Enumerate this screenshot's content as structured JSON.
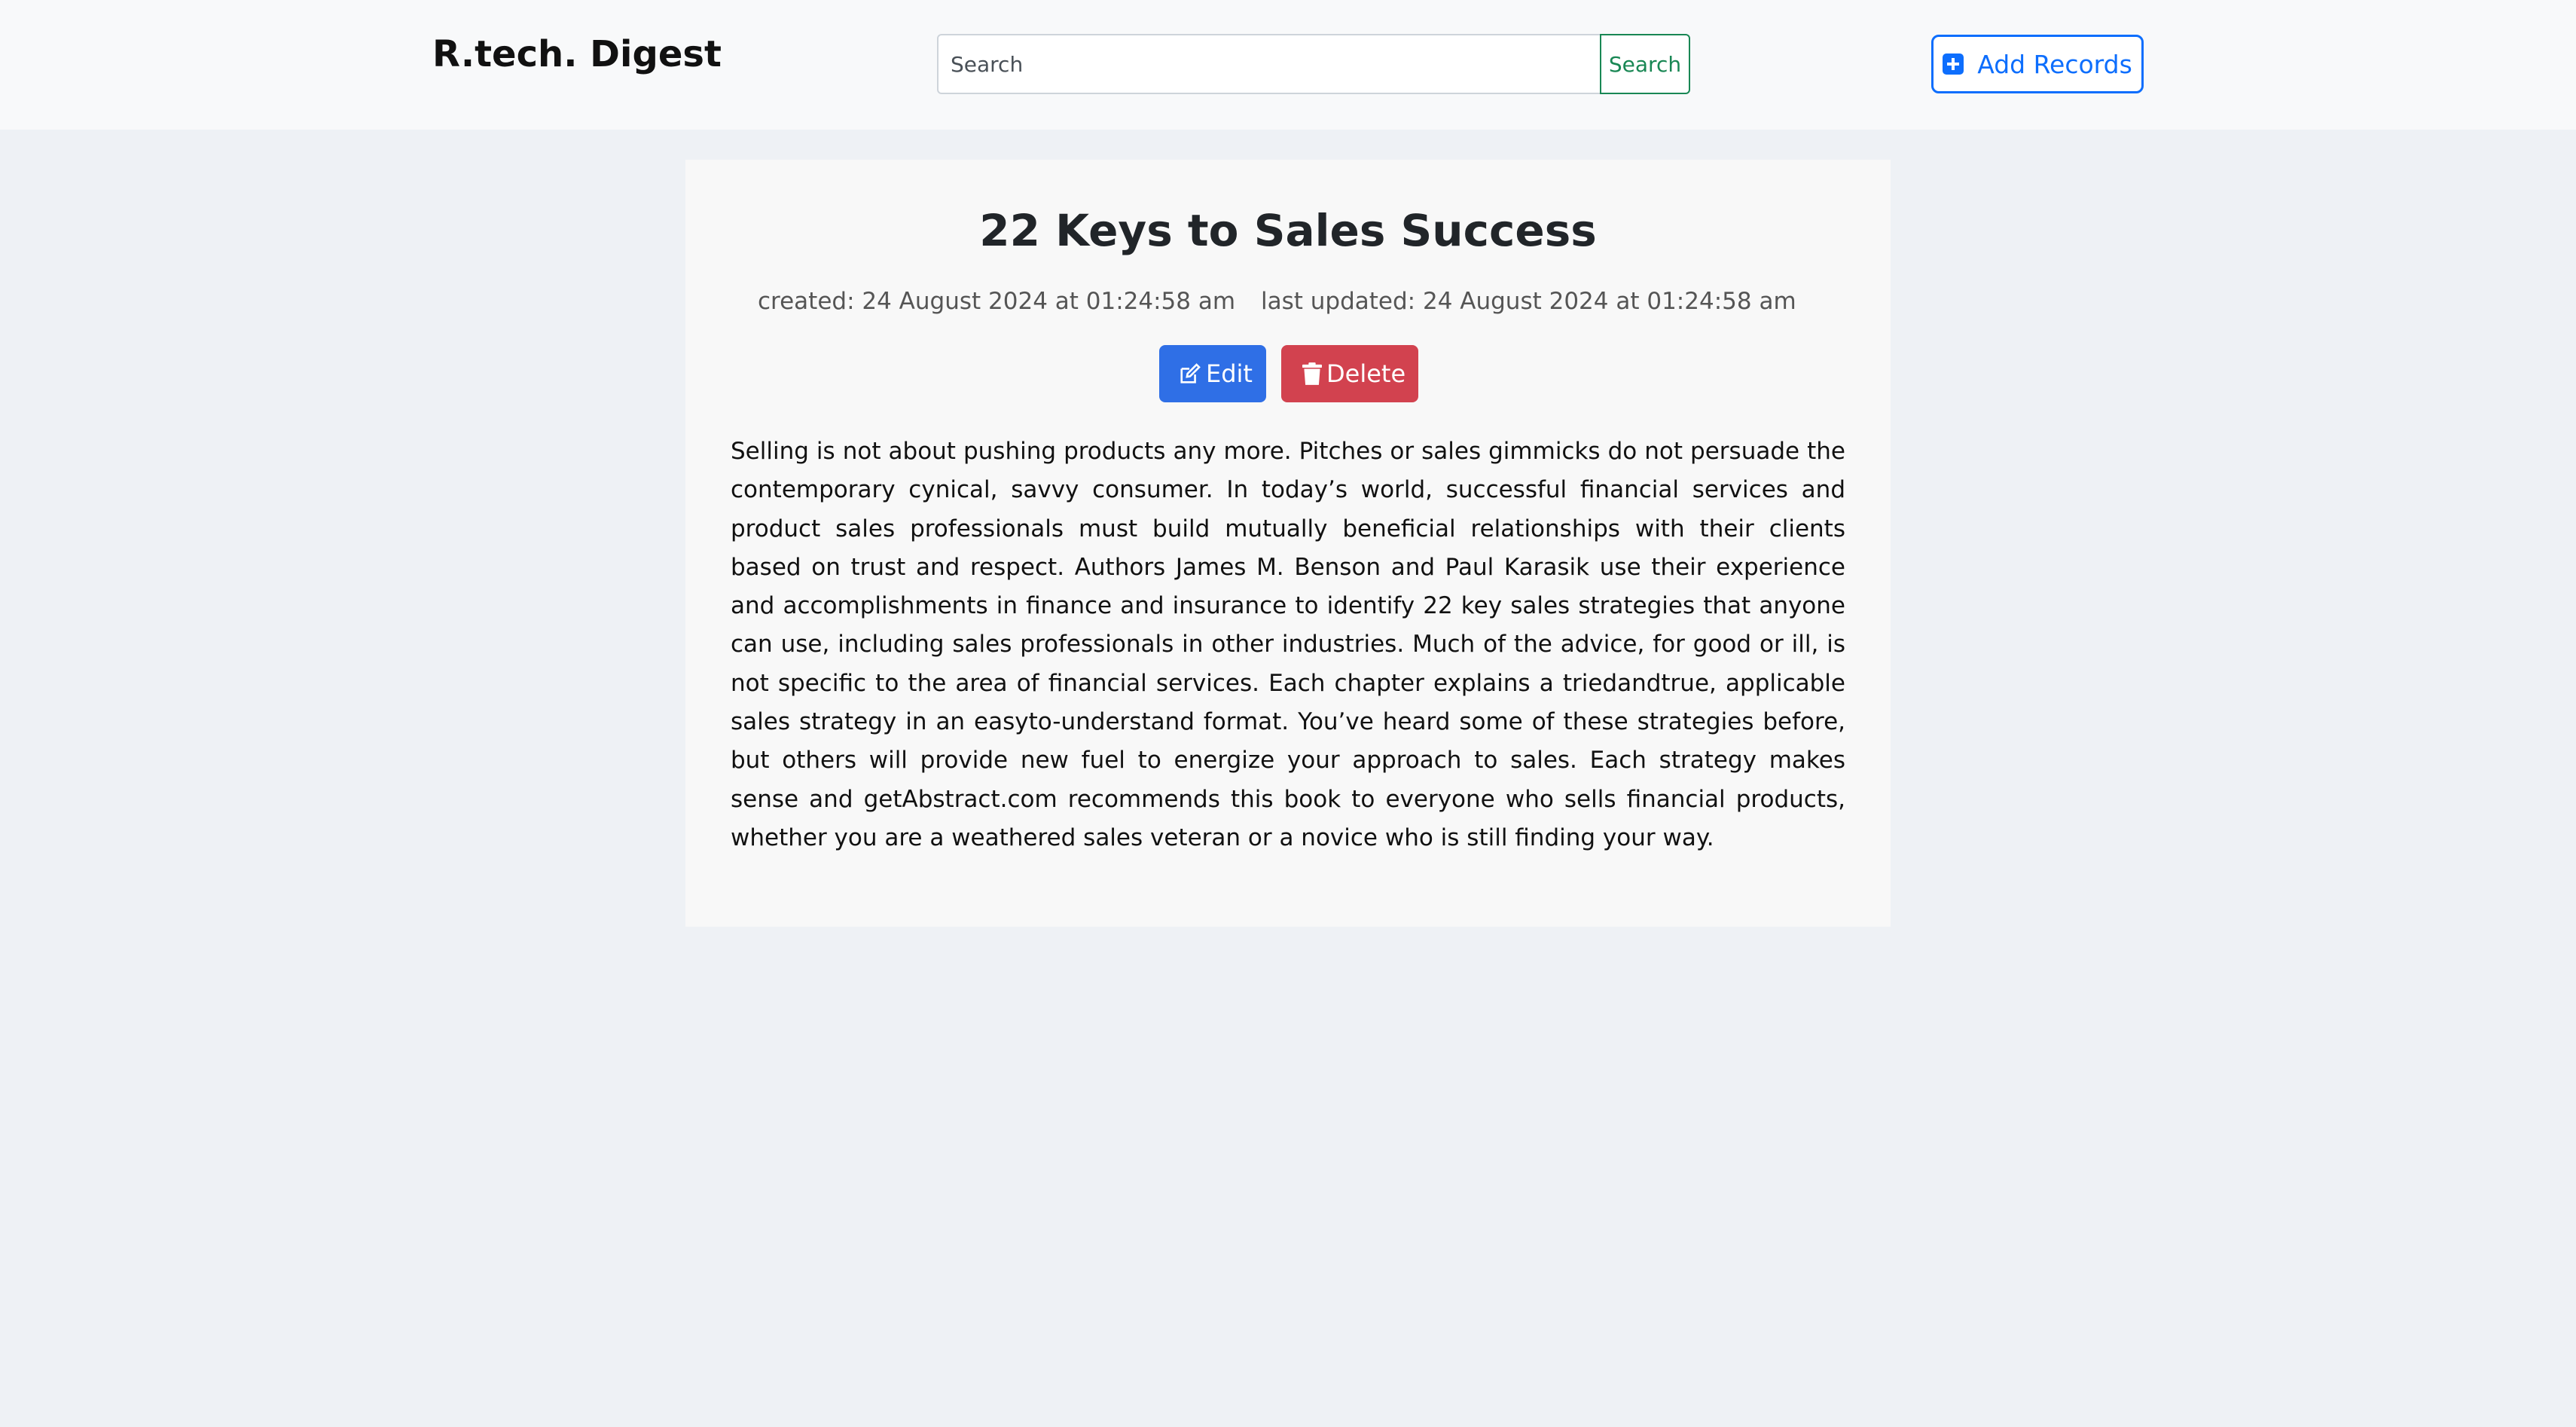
{
  "navbar": {
    "brand": "R.tech. Digest",
    "search_placeholder": "Search",
    "search_button": "Search",
    "add_button": "Add Records"
  },
  "article": {
    "title": "22 Keys to Sales Success",
    "created": "created: 24 August 2024 at 01:24:58 am",
    "updated": "last updated: 24 August 2024 at 01:24:58 am",
    "edit_label": "Edit",
    "delete_label": "Delete",
    "body": "Selling is not about pushing products any more. Pitches or sales gimmicks do not persuade the contemporary cynical, savvy consumer. In today’s world, successful financial services and product sales professionals must build mutually beneficial relationships with their clients based on trust and respect. Authors James M. Benson and Paul Karasik use their experience and accomplishments in finance and insurance to identify 22 key sales strategies that anyone can use, including sales professionals in other industries. Much of the advice, for good or ill, is not specific to the area of financial services. Each chapter explains a triedandtrue, applicable sales strategy in an easyto-understand format. You’ve heard some of these strategies before, but others will provide new fuel to energize your approach to sales. Each strategy makes sense and getAbstract.com recommends this book to everyone who sells financial products, whether you are a weathered sales veteran or a novice who is still finding your way."
  },
  "icons": {
    "add": "plus-square-icon",
    "edit": "edit-icon",
    "delete": "trash-icon"
  },
  "colors": {
    "primary": "#0d6efd",
    "edit": "#2f6fe6",
    "delete": "#d2424f",
    "search": "#198754",
    "background": "#eef1f5"
  }
}
